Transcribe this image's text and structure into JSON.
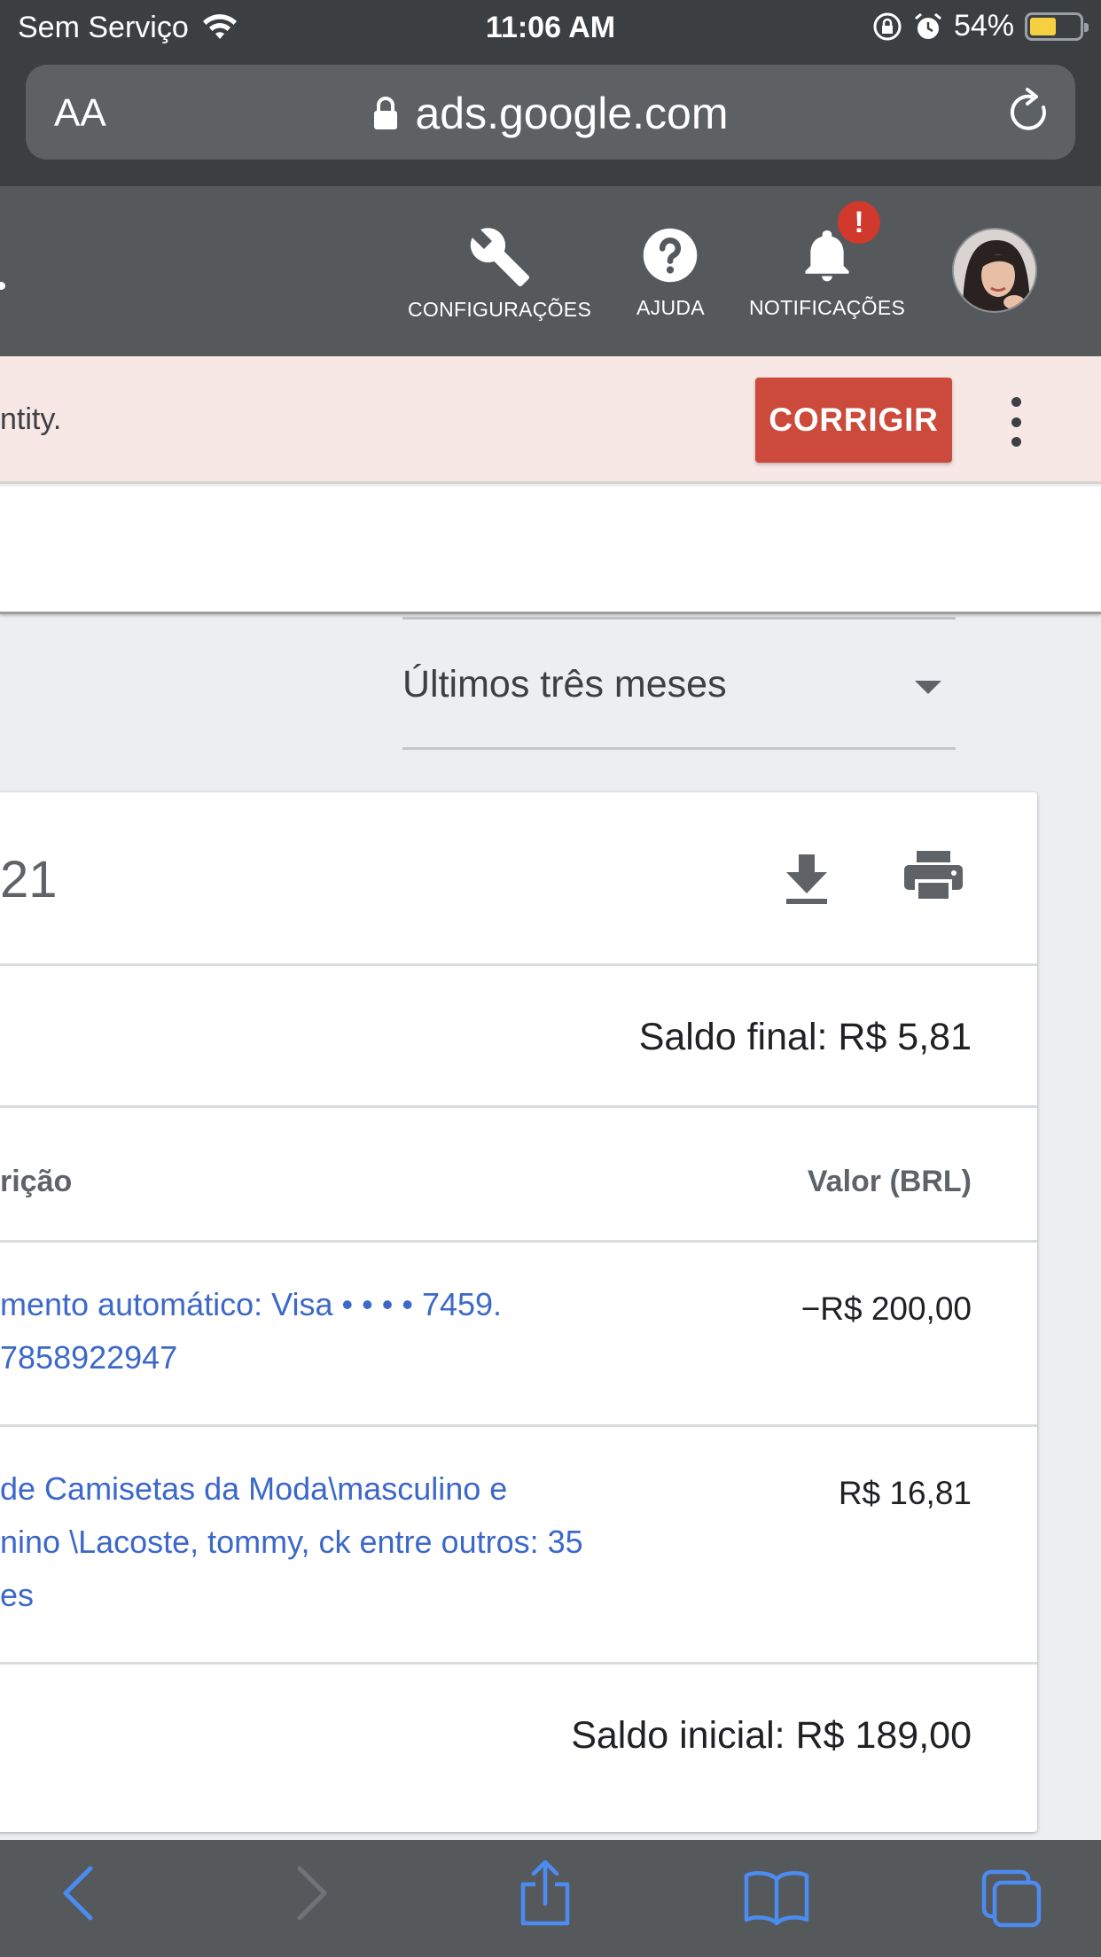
{
  "status_bar": {
    "carrier": "Sem Serviço",
    "time": "11:06 AM",
    "battery_percent": "54%",
    "battery_level": 0.54
  },
  "browser": {
    "text_size_label": "AA",
    "domain": "ads.google.com"
  },
  "app_header": {
    "settings_label": "CONFIGURAÇÕES",
    "help_label": "AJUDA",
    "notifications_label": "NOTIFICAÇÕES",
    "notification_badge": "!"
  },
  "alert": {
    "text": "ntity.",
    "fix_label": "CORRIGIR"
  },
  "date_range": {
    "selected": "Últimos três meses"
  },
  "statement": {
    "title_fragment": "21",
    "final_balance": "Saldo final: R$ 5,81",
    "col_description": "rição",
    "col_amount": "Valor (BRL)",
    "transactions": [
      {
        "desc_line1": "mento automático: Visa  • • • • 7459.",
        "desc_line2": "7858922947",
        "desc_line3": "",
        "amount": "−R$ 200,00"
      },
      {
        "desc_line1": "de Camisetas da Moda\\masculino e",
        "desc_line2": "nino \\Lacoste, tommy, ck entre outros: 35",
        "desc_line3": "es",
        "amount": "R$ 16,81"
      }
    ],
    "initial_balance": "Saldo inicial: R$ 189,00"
  },
  "colors": {
    "header_bg": "#56595c",
    "alert_bg": "#f7e8e6",
    "fix_button": "#cc4a3b",
    "link_blue": "#3c68c9",
    "toolbar_blue": "#4a8cf2"
  }
}
